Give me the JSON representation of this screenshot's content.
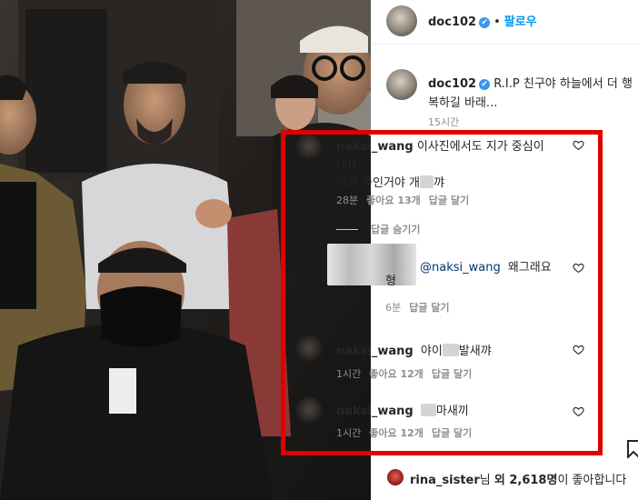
{
  "header": {
    "username": "doc102",
    "verified_symbol": "✔",
    "separator": "•",
    "follow_label": "팔로우"
  },
  "caption": {
    "username": "doc102",
    "line1": "R.I.P 친구야 하늘에서 더 행",
    "line2": "복하길 바래...",
    "time": "15시간"
  },
  "comments": [
    {
      "username": "naksi_wang",
      "line1": "이사진에서도 지가 중심이",
      "line2": "네!!",
      "line3_prefix": "너가 죽인거야 개",
      "line3_suffix": "꺄",
      "time": "28분",
      "likes": "좋아요 13개",
      "reply": "답글 달기",
      "hide_replies": "답글 숨기기"
    },
    {
      "mention": "@naksi_wang",
      "text": "왜그래요",
      "text2": "형",
      "time": "6분",
      "reply": "답글 달기"
    },
    {
      "username": "naksi_wang",
      "text_prefix": "야이",
      "text_suffix": "발새꺄",
      "time": "1시간",
      "likes": "좋아요 12개",
      "reply": "답글 달기"
    },
    {
      "username": "naksi_wang",
      "text_suffix": "마새끼",
      "time": "1시간",
      "likes": "좋아요 12개",
      "reply": "답글 달기"
    }
  ],
  "footer": {
    "liker": "rina_sister",
    "liked_text_1": "님 ",
    "liked_text_bold": "외 2,618명",
    "liked_text_2": "이 좋아합니다"
  },
  "colors": {
    "highlight_border": "#e00000",
    "link_blue": "#0095f6",
    "muted_gray": "#8e8e8e"
  },
  "icons": [
    "heart-icon",
    "verified-badge-icon",
    "bookmark-icon"
  ]
}
